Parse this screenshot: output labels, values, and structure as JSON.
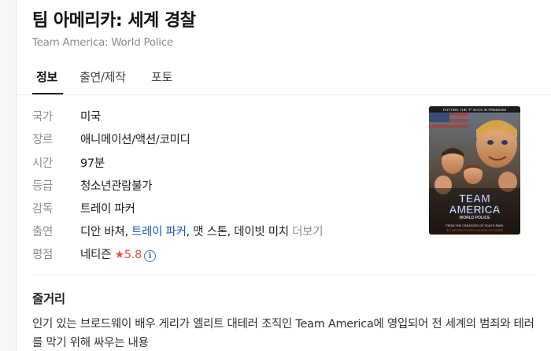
{
  "movie": {
    "title": "팀 아메리카: 세계 경찰",
    "original_title": "Team America: World Police"
  },
  "tabs": [
    {
      "label": "정보",
      "active": true
    },
    {
      "label": "출연/제작",
      "active": false
    },
    {
      "label": "포토",
      "active": false
    }
  ],
  "info": {
    "country": {
      "label": "국가",
      "value": "미국"
    },
    "genre": {
      "label": "장르",
      "value": "애니메이션/액션/코미디"
    },
    "runtime": {
      "label": "시간",
      "value": "97분"
    },
    "rating": {
      "label": "등급",
      "value": "청소년관람불가"
    },
    "director": {
      "label": "감독",
      "value": "트레이 파커"
    },
    "cast": {
      "label": "출연",
      "name1": "디안 바쳐,",
      "name2_link": "트레이 파커",
      "name3": ", 맷 스톤, 데이빗 미치",
      "more": "더보기"
    },
    "score": {
      "label": "평점",
      "source": "네티즌",
      "star": "★",
      "value": "5.8",
      "info_icon": "info-icon"
    }
  },
  "poster": {
    "tagline_top": "PUTTING THE \"F\" BACK IN FREEDOM",
    "logo_line1": "TEAM",
    "logo_line2": "AMERICA",
    "logo_line3": "WORLD POLICE",
    "bottom_line1": "FROM THE CREATORS OF SOUTH PARK",
    "bottom_line2": "IN THEATRES EVERYWHERE OCTOBER"
  },
  "synopsis": {
    "heading": "줄거리",
    "text": "인기 있는 브로드웨이 배우 게리가 엘리트 대테러 조직인 Team America에 영입되어 전 세계의 범죄와 테러를 막기 위해 싸우는 내용"
  },
  "colors": {
    "link": "#1a55c8",
    "score": "#f04a36",
    "label": "#8a8d91"
  }
}
